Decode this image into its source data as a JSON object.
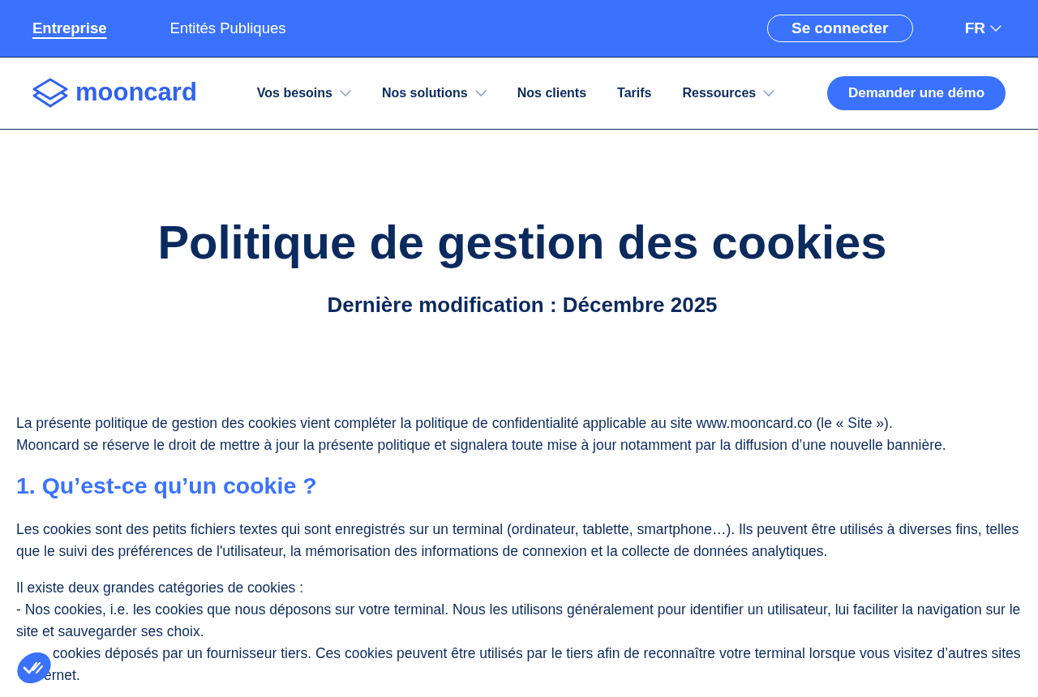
{
  "top_bar": {
    "segments": [
      {
        "label": "Entreprise",
        "selected": true
      },
      {
        "label": "Entités Publiques",
        "selected": false
      }
    ],
    "login_button": "Se connecter",
    "language": "FR"
  },
  "nav": {
    "logo": "mooncard",
    "items": [
      {
        "label": "Vos besoins",
        "has_menu": true
      },
      {
        "label": "Nos solutions",
        "has_menu": true
      },
      {
        "label": "Nos clients",
        "has_menu": false
      },
      {
        "label": "Tarifs",
        "has_menu": false
      },
      {
        "label": "Ressources",
        "has_menu": true
      }
    ],
    "cta_button": "Demander une démo"
  },
  "page": {
    "title": "Politique de gestion des cookies",
    "subtitle": "Dernière modification : Décembre 2025"
  },
  "content": [
    {
      "kind": "paragraph",
      "lines": [
        "La présente politique de gestion des cookies vient compléter la politique de confidentialité applicable au site www.mooncard.co (le « Site »).",
        "Mooncard se réserve le droit de mettre à jour la présente politique et signalera toute mise à jour notamment par la diffusion d’une nouvelle bannière."
      ]
    },
    {
      "kind": "heading",
      "lines": [
        "1. Qu’est-ce qu’un cookie ?"
      ]
    },
    {
      "kind": "paragraph",
      "lines": [
        "Les cookies sont des petits fichiers textes qui sont enregistrés sur un terminal (ordinateur, tablette, smartphone…). Ils peuvent être utilisés à diverses fins, telles que le suivi des préférences de l'utilisateur, la mémorisation des informations de connexion et la collecte de données analytiques."
      ]
    },
    {
      "kind": "paragraph",
      "lines": [
        "Il existe deux grandes catégories de cookies :",
        "- Nos cookies, i.e. les cookies que nous déposons sur votre terminal. Nous les utilisons généralement pour identifier un utilisateur, lui faciliter la navigation sur le site et sauvegarder ses choix."
      ]
    },
    {
      "kind": "covered_item",
      "fragments": [
        "cookies déposés par un fournisseur tiers. Ces cookies peuvent être utilisés par le tiers afin de reconnaître votre terminal lorsque vous visitez d’autres sites",
        "ernet."
      ]
    }
  ]
}
